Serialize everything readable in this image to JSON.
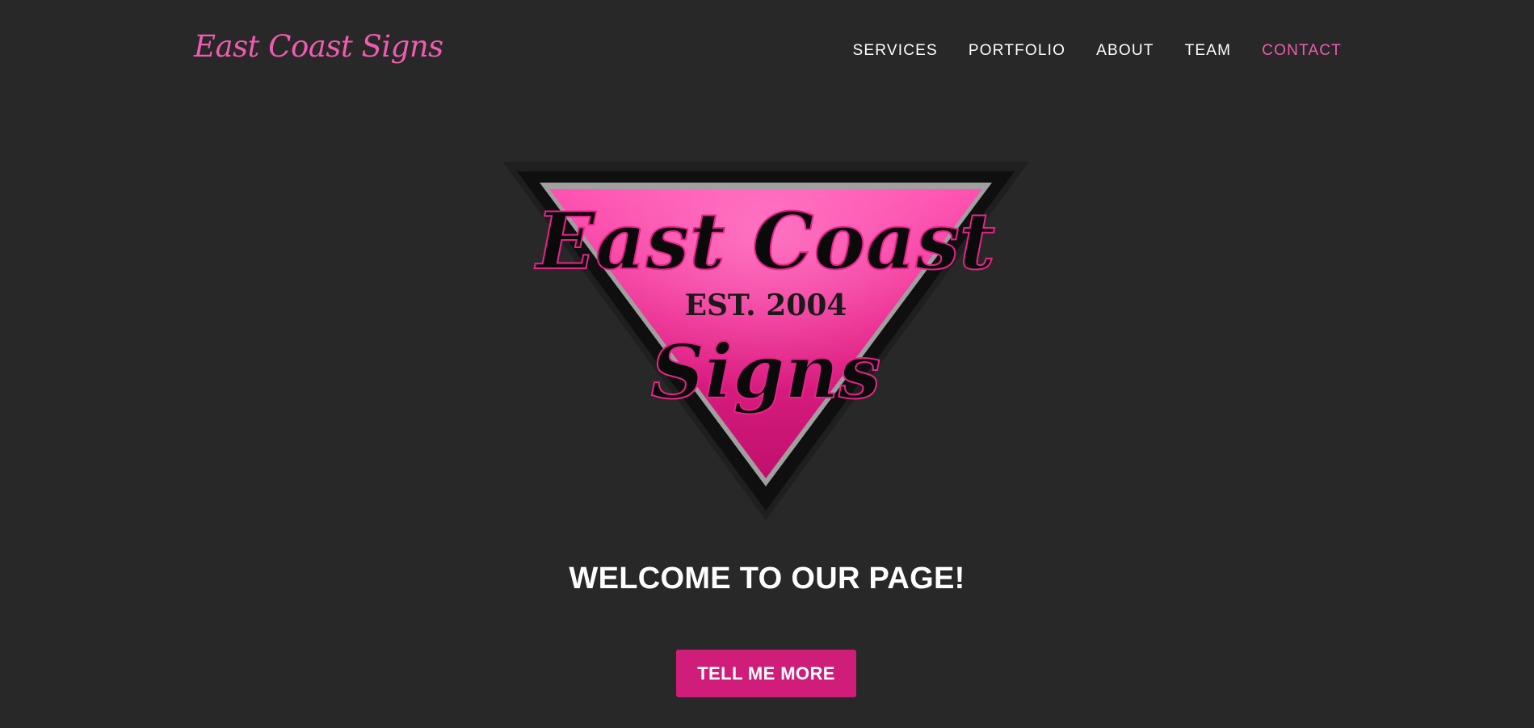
{
  "brand": {
    "name": "East Coast Signs"
  },
  "nav": {
    "items": [
      {
        "label": "SERVICES"
      },
      {
        "label": "PORTFOLIO"
      },
      {
        "label": "ABOUT"
      },
      {
        "label": "TEAM"
      },
      {
        "label": "CONTACT"
      }
    ],
    "active": "CONTACT"
  },
  "hero": {
    "logo": {
      "line1": "East Coast",
      "line2": "EST. 2004",
      "line3": "Signs"
    },
    "headline": "WELCOME TO OUR PAGE!",
    "cta_label": "TELL ME MORE"
  },
  "colors": {
    "background": "#282828",
    "accent": "#f05bb0",
    "button": "#cf1d79",
    "logo_pink": "#e8238a",
    "logo_pink_light": "#ff4fb0",
    "logo_border": "#a0a0a0"
  },
  "icons": []
}
